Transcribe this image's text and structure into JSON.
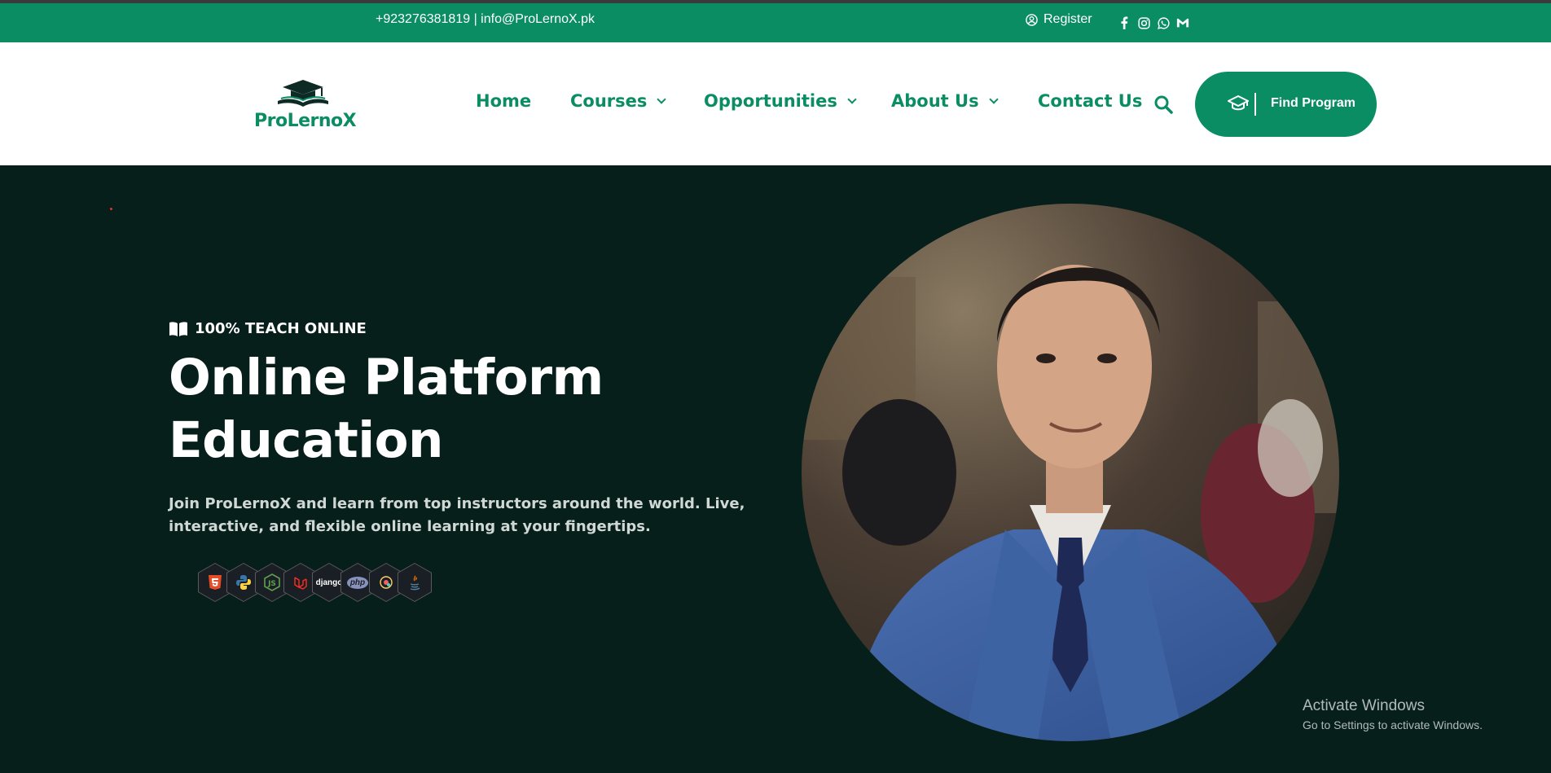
{
  "topbar": {
    "contact": "+923276381819 | info@ProLernoX.pk",
    "register_label": "Register",
    "socials": [
      "facebook-icon",
      "instagram-icon",
      "whatsapp-icon",
      "gmail-icon"
    ]
  },
  "brand": {
    "name": "ProLernoX",
    "color": "#0b8d64"
  },
  "nav": {
    "home": "Home",
    "courses": "Courses",
    "opportunities": "Opportunities",
    "about": "About Us",
    "contact": "Contact Us",
    "find_program": "Find Program"
  },
  "hero": {
    "tag": "100% TEACH ONLINE",
    "headline_line1": "Online Platform",
    "headline_line2": "Education",
    "description": "Join ProLernoX and learn from top instructors around the world. Live, interactive, and flexible online learning at your fingertips.",
    "tech_icons": [
      "html5-icon",
      "python-icon",
      "nodejs-icon",
      "laravel-icon",
      "django-icon",
      "php-icon",
      "react-icon",
      "java-icon"
    ],
    "tech_labels": {
      "django": "django",
      "php": "php"
    },
    "background": "#071f1b"
  },
  "watermark": {
    "line1": "Activate Windows",
    "line2": "Go to Settings to activate Windows."
  }
}
